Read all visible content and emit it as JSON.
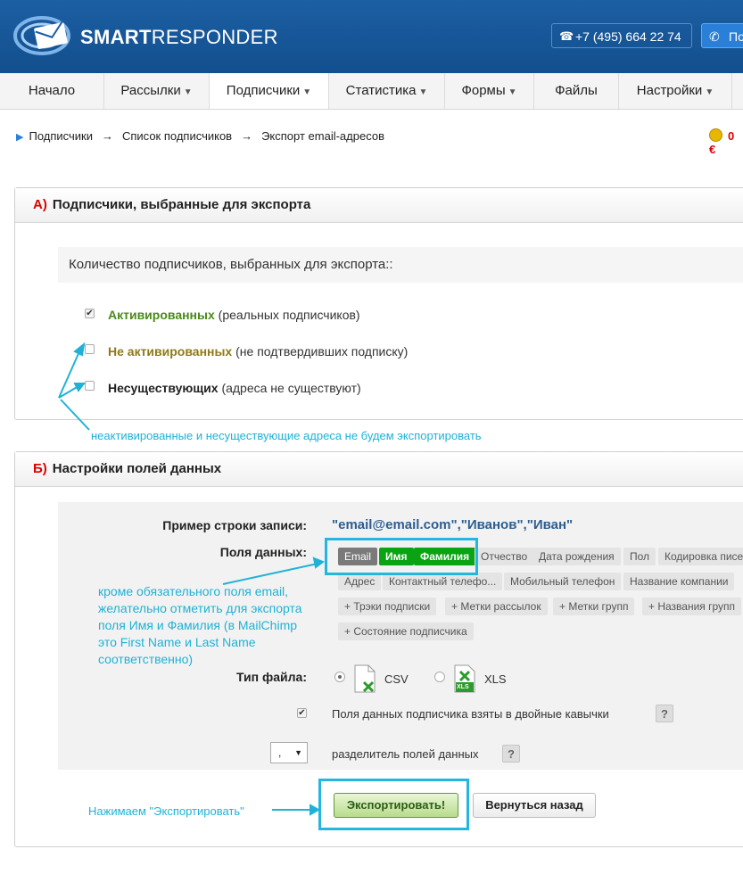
{
  "header": {
    "logo_text_bold": "SMART",
    "logo_text_rest": "RESPONDER",
    "phone": "+7 (495) 664 22 74",
    "callback_label": "По"
  },
  "nav": {
    "items": [
      {
        "label": "Начало",
        "has_caret": false
      },
      {
        "label": "Рассылки",
        "has_caret": true
      },
      {
        "label": "Подписчики",
        "has_caret": true
      },
      {
        "label": "Статистика",
        "has_caret": true
      },
      {
        "label": "Формы",
        "has_caret": true
      },
      {
        "label": "Файлы",
        "has_caret": false
      },
      {
        "label": "Настройки",
        "has_caret": true
      }
    ]
  },
  "breadcrumb": {
    "items": [
      "Подписчики",
      "Список подписчиков",
      "Экспорт email-адресов"
    ],
    "separator": "→"
  },
  "balance": "0 €",
  "section_a": {
    "letter": "А)",
    "title": "Подписчики, выбранные для экспорта",
    "count_label": "Количество подписчиков, выбранных для экспорта::",
    "options": [
      {
        "bold": "Активированных",
        "note": "(реальных подписчиков)",
        "checked": true
      },
      {
        "bold": "Не активированных",
        "note": "(не подтвердивших подписку)",
        "checked": false
      },
      {
        "bold": "Несуществующих",
        "note": "(адреса не существуют)",
        "checked": false
      }
    ],
    "annotation": "неактивированные и несуществующие адреса не будем экспортировать"
  },
  "section_b": {
    "letter": "Б)",
    "title": "Настройки полей данных",
    "example_label": "Пример строки записи:",
    "example_value": "\"email@email.com\",\"Иванов\",\"Иван\"",
    "fields_label": "Поля данных:",
    "selected_fields": [
      "Email",
      "Имя",
      "Фамилия"
    ],
    "available_fields_row1": [
      "Отчество",
      "Дата рождения",
      "Пол",
      "Кодировка писем"
    ],
    "available_fields_row2": [
      "Адрес",
      "Контактный телефо...",
      "Мобильный телефон",
      "Название компании"
    ],
    "extra_fields_row3": [
      "+ Трэки подписки",
      "+ Метки рассылок",
      "+ Метки групп",
      "+ Названия групп"
    ],
    "extra_fields_row4": [
      "+ Состояние подписчика"
    ],
    "annotation_fields": [
      "кроме обязательного поля email,",
      "желательно отметить для экспорта",
      "поля Имя и Фамилия (в MailChimp",
      "это First Name и Last Name",
      "соответственно)"
    ],
    "file_type_label": "Тип файла:",
    "file_types": [
      {
        "label": "CSV",
        "selected": true
      },
      {
        "label": "XLS",
        "selected": false
      }
    ],
    "xls_icon_text": "XLS",
    "quotes_label": "Поля данных подписчика взяты в двойные кавычки",
    "quotes_checked": true,
    "separator_value": ",",
    "separator_label": "разделитель полей данных",
    "help_glyph": "?",
    "export_button": "Экспортировать!",
    "back_button": "Вернуться назад",
    "annotation_export": "Нажимаем \"Экспортировать\""
  }
}
